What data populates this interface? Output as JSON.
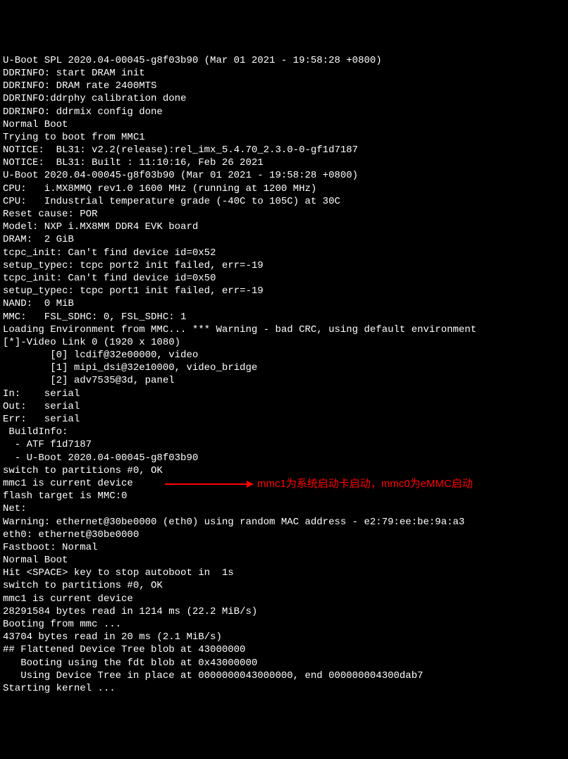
{
  "lines": [
    "U-Boot SPL 2020.04-00045-g8f03b90 (Mar 01 2021 - 19:58:28 +0800)",
    "DDRINFO: start DRAM init",
    "DDRINFO: DRAM rate 2400MTS",
    "DDRINFO:ddrphy calibration done",
    "DDRINFO: ddrmix config done",
    "Normal Boot",
    "Trying to boot from MMC1",
    "NOTICE:  BL31: v2.2(release):rel_imx_5.4.70_2.3.0-0-gf1d7187",
    "NOTICE:  BL31: Built : 11:10:16, Feb 26 2021",
    "",
    "",
    "U-Boot 2020.04-00045-g8f03b90 (Mar 01 2021 - 19:58:28 +0800)",
    "",
    "CPU:   i.MX8MMQ rev1.0 1600 MHz (running at 1200 MHz)",
    "CPU:   Industrial temperature grade (-40C to 105C) at 30C",
    "Reset cause: POR",
    "Model: NXP i.MX8MM DDR4 EVK board",
    "DRAM:  2 GiB",
    "tcpc_init: Can't find device id=0x52",
    "setup_typec: tcpc port2 init failed, err=-19",
    "tcpc_init: Can't find device id=0x50",
    "setup_typec: tcpc port1 init failed, err=-19",
    "NAND:  0 MiB",
    "MMC:   FSL_SDHC: 0, FSL_SDHC: 1",
    "Loading Environment from MMC... *** Warning - bad CRC, using default environment",
    "",
    "[*]-Video Link 0 (1920 x 1080)",
    "        [0] lcdif@32e00000, video",
    "        [1] mipi_dsi@32e10000, video_bridge",
    "        [2] adv7535@3d, panel",
    "In:    serial",
    "Out:   serial",
    "Err:   serial",
    "",
    " BuildInfo:",
    "  - ATF f1d7187",
    "  - U-Boot 2020.04-00045-g8f03b90",
    "",
    "switch to partitions #0, OK",
    "mmc1 is current device",
    "flash target is MMC:0",
    "Net:   ",
    "Warning: ethernet@30be0000 (eth0) using random MAC address - e2:79:ee:be:9a:a3",
    "eth0: ethernet@30be0000",
    "Fastboot: Normal",
    "Normal Boot",
    "Hit <SPACE> key to stop autoboot in  1s",
    "switch to partitions #0, OK",
    "mmc1 is current device",
    "28291584 bytes read in 1214 ms (22.2 MiB/s)",
    "Booting from mmc ...",
    "43704 bytes read in 20 ms (2.1 MiB/s)",
    "## Flattened Device Tree blob at 43000000",
    "   Booting using the fdt blob at 0x43000000",
    "   Using Device Tree in place at 0000000043000000, end 000000004300dab7",
    "",
    "Starting kernel ..."
  ],
  "annotation": {
    "text": "mmc1为系统启动卡启动，mmc0为eMMC启动",
    "target_line_index": 39
  }
}
